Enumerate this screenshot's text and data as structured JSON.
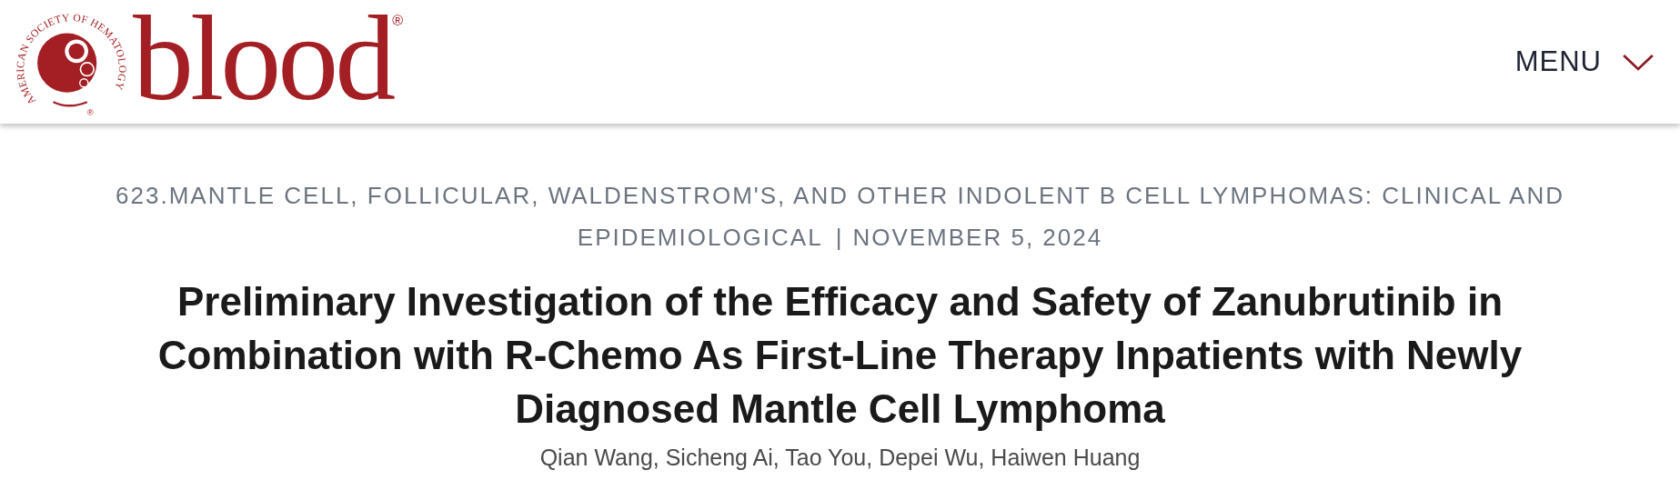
{
  "header": {
    "logo": {
      "seal_text": "AMERICAN SOCIETY OF HEMATOLOGY",
      "seal_mark": "®",
      "wordmark": "blood",
      "wordmark_mark": "®"
    },
    "menu": {
      "label": "MENU"
    }
  },
  "article": {
    "category": "623.MANTLE CELL, FOLLICULAR, WALDENSTROM'S, AND OTHER INDOLENT B CELL LYMPHOMAS: CLINICAL AND EPIDEMIOLOGICAL",
    "separator": "|",
    "date": "NOVEMBER 5, 2024",
    "title": "Preliminary Investigation of the Efficacy and Safety of Zanubrutinib in Combination with R-Chemo As First-Line Therapy Inpatients with Newly Diagnosed Mantle Cell Lymphoma",
    "authors": "Qian Wang, Sicheng Ai, Tao You, Depei Wu, Haiwen Huang"
  }
}
